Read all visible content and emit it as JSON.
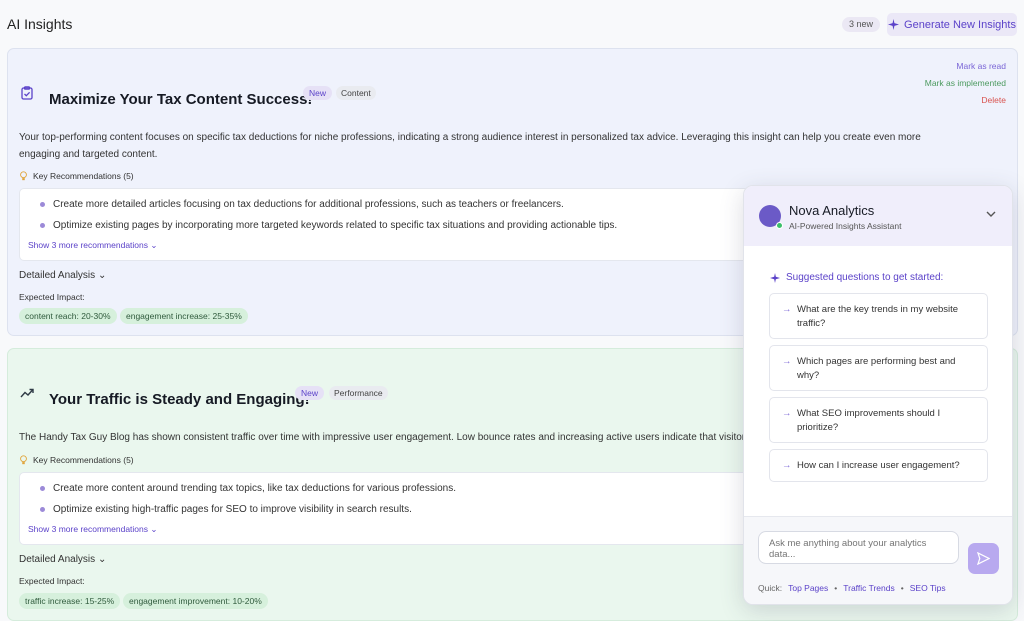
{
  "header": {
    "title": "AI Insights",
    "badge": "3 new",
    "generate_label": "Generate New Insights"
  },
  "cards": [
    {
      "title": "Maximize Your Tax Content Success!",
      "new_tag": "New",
      "category": "Content",
      "actions": {
        "mark_read": "Mark as read",
        "mark_implemented": "Mark as implemented",
        "delete": "Delete"
      },
      "summary_line1": "Your top-performing content focuses on specific tax deductions for niche professions, indicating a strong audience interest in personalized tax advice. Leveraging this insight can help you create even more",
      "summary_line2": "engaging and targeted content.",
      "rec_head": "Key Recommendations (5)",
      "recs": [
        "Create more detailed articles focusing on tax deductions for additional professions, such as teachers or freelancers.",
        "Optimize existing pages by incorporating more targeted keywords related to specific tax situations and providing actionable tips."
      ],
      "show_more": "Show 3 more recommendations",
      "detail": "Detailed Analysis",
      "impact_label": "Expected Impact:",
      "impacts": [
        "content reach: 20-30%",
        "engagement increase: 25-35%"
      ]
    },
    {
      "title": "Your Traffic is Steady and Engaging!",
      "new_tag": "New",
      "category": "Performance",
      "summary_line1": "The Handy Tax Guy Blog has shown consistent traffic over time with impressive user engagement. Low bounce rates and increasing active users indicate that visitors a",
      "rec_head": "Key Recommendations (5)",
      "recs": [
        "Create more content around trending tax topics, like tax deductions for various professions.",
        "Optimize existing high-traffic pages for SEO to improve visibility in search results."
      ],
      "show_more": "Show 3 more recommendations",
      "detail": "Detailed Analysis",
      "impact_label": "Expected Impact:",
      "impacts": [
        "traffic increase: 15-25%",
        "engagement improvement: 10-20%"
      ]
    }
  ],
  "chat": {
    "name": "Nova Analytics",
    "subtitle": "AI-Powered Insights Assistant",
    "suggest_head": "Suggested questions to get started:",
    "suggestions": [
      "What are the key trends in my website traffic?",
      "Which pages are performing best and why?",
      "What SEO improvements should I prioritize?",
      "How can I increase user engagement?"
    ],
    "input_placeholder": "Ask me anything about your analytics data...",
    "quick_label": "Quick:",
    "quick": [
      "Top Pages",
      "Traffic Trends",
      "SEO Tips"
    ],
    "separator": "•"
  },
  "colors": {
    "accent": "#5b42c9",
    "implemented": "#4c9a5f",
    "delete": "#d9534f"
  }
}
